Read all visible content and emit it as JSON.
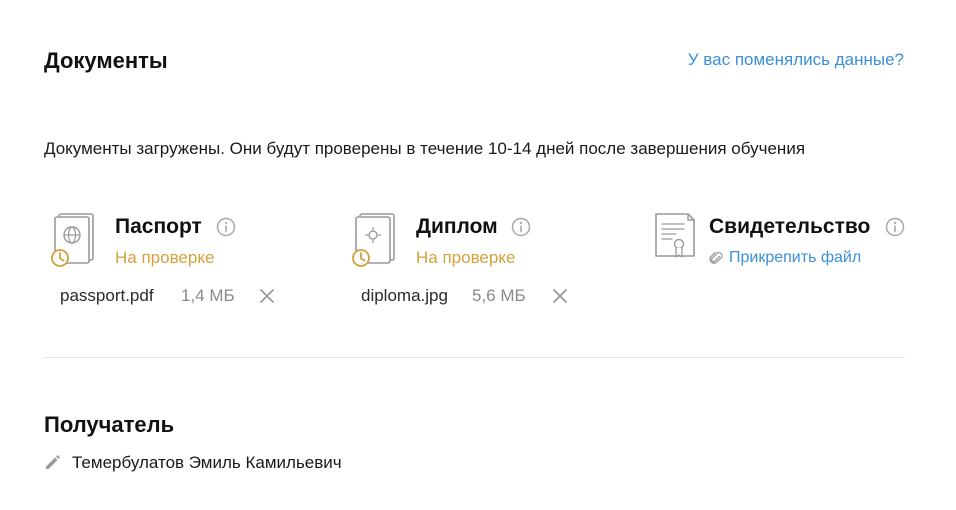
{
  "documents": {
    "title": "Документы",
    "changed_data_link": "У вас поменялись данные?",
    "info_text": "Документы загружены. Они будут проверены в течение 10-14 дней после завершения обучения",
    "items": [
      {
        "title": "Паспорт",
        "status": "На проверке",
        "file_name": "passport.pdf",
        "file_size": "1,4 МБ",
        "icon": "passport-icon"
      },
      {
        "title": "Диплом",
        "status": "На проверке",
        "file_name": "diploma.jpg",
        "file_size": "5,6 МБ",
        "icon": "diploma-icon"
      },
      {
        "title": "Свидетельство",
        "attach_label": "Прикрепить файл",
        "icon": "certificate-icon"
      }
    ]
  },
  "recipient": {
    "title": "Получатель",
    "name": "Темербулатов Эмиль Камильевич"
  },
  "colors": {
    "link": "#3c8fd8",
    "pending": "#d4a23c",
    "muted": "#8a8a8a",
    "icon_gray": "#9a9a9a"
  }
}
